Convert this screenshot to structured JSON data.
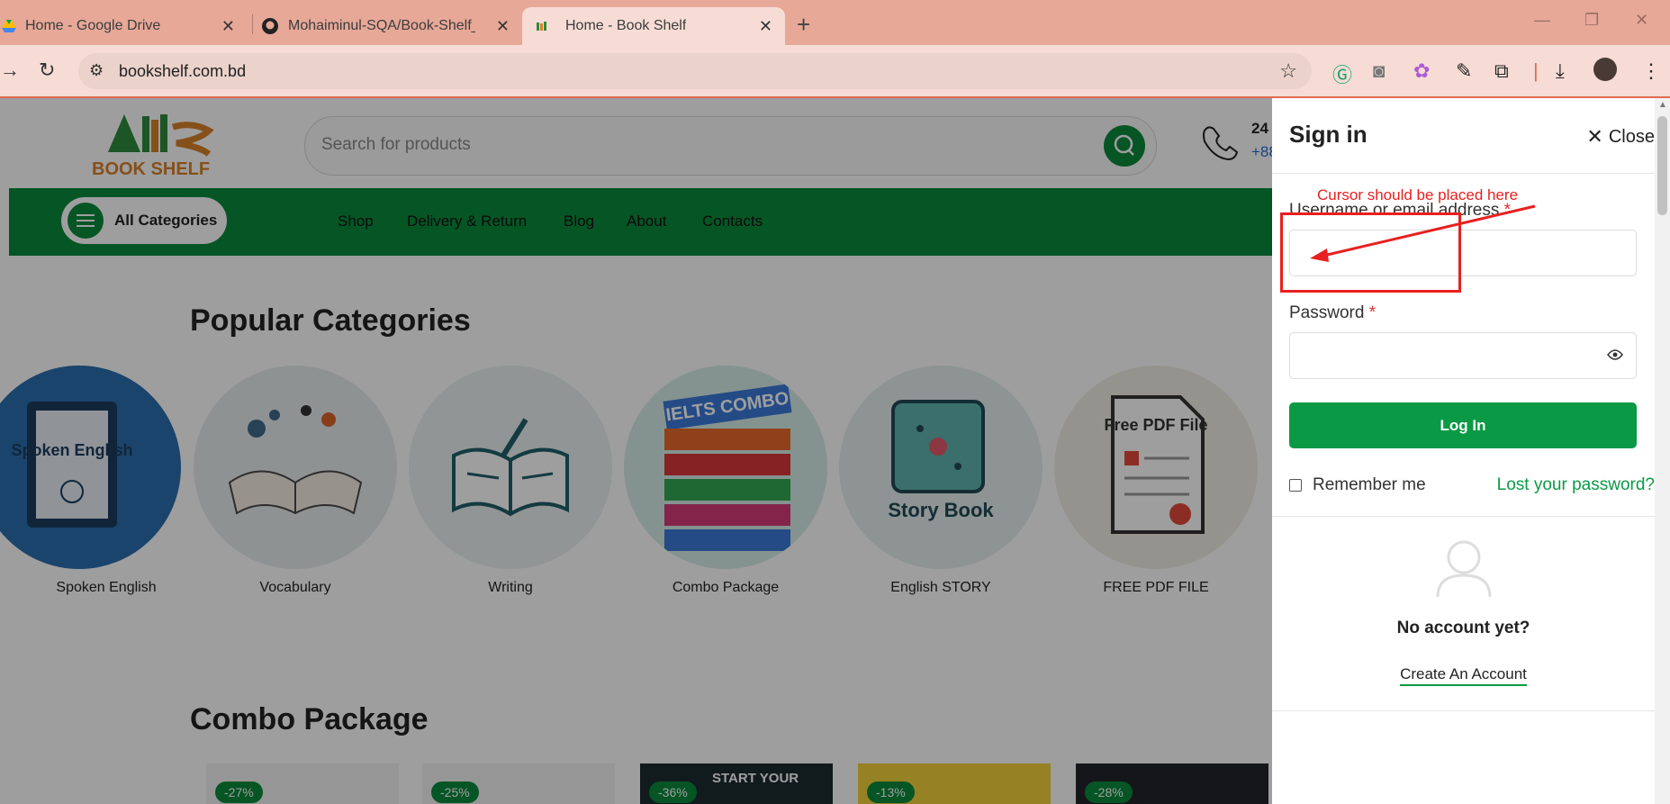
{
  "browser": {
    "tabs": [
      {
        "title": "Home - Google Drive"
      },
      {
        "title": "Mohaiminul-SQA/Book-Shelf_M"
      },
      {
        "title": "Home - Book Shelf"
      }
    ],
    "url": "bookshelf.com.bd"
  },
  "site": {
    "logo_text": "BOOK SHELF",
    "search_placeholder": "Search for products",
    "phone_line1": "24",
    "phone_line2": "+88",
    "all_categories": "All Categories",
    "menu": [
      "Shop",
      "Delivery & Return",
      "Blog",
      "About",
      "Contacts"
    ],
    "popular_title": "Popular Categories",
    "categories": [
      {
        "name": "Spoken English",
        "art": "Spoken English"
      },
      {
        "name": "Vocabulary",
        "art": ""
      },
      {
        "name": "Writing",
        "art": ""
      },
      {
        "name": "Combo Package",
        "art": "IELTS COMBO"
      },
      {
        "name": "English STORY",
        "art": "Story Book"
      },
      {
        "name": "FREE PDF FILE",
        "art": "Free PDF File"
      }
    ],
    "combo_title": "Combo Package",
    "discounts": [
      "-27%",
      "-25%",
      "-36%",
      "-13%",
      "-28%"
    ],
    "combo_banner_text": "START YOUR"
  },
  "signin": {
    "title": "Sign in",
    "close": "Close",
    "username_label": "Username or email address",
    "password_label": "Password",
    "required_mark": "*",
    "login": "Log In",
    "remember": "Remember me",
    "lost": "Lost your password?",
    "no_account": "No account yet?",
    "create": "Create An Account"
  },
  "annotation": {
    "text": "Cursor should be placed here",
    "color": "#e82020"
  },
  "colors": {
    "brand_green": "#0a8a3c",
    "button_green": "#0a9a45",
    "tab_strip": "#e7a898"
  }
}
